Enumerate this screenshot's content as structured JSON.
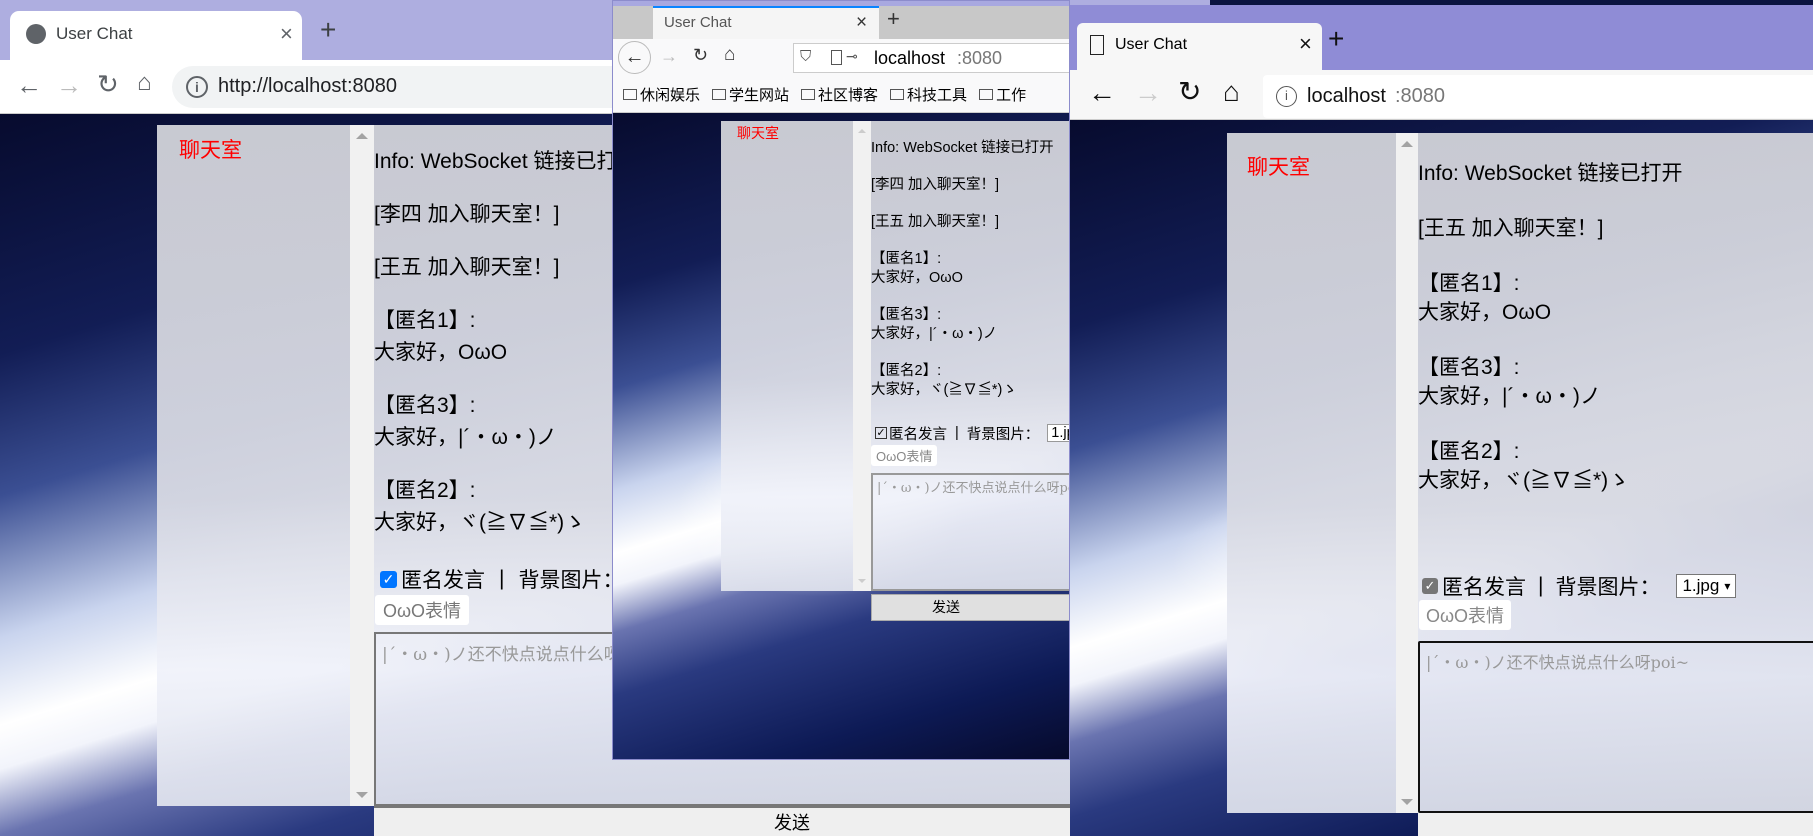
{
  "chat": {
    "room_title": "聊天室",
    "anonymous_label": "匿名发言",
    "separator": "|",
    "bg_label": "背景图片：",
    "bg_select_value": "1.jpg",
    "emoji_button": "OωO表情",
    "input_placeholder": "|´・ω・)ノ还不快点说点什么呀poi~",
    "send_label": "发送"
  },
  "windows": [
    {
      "browser": "Chrome",
      "tab_title": "User Chat",
      "url": "http://localhost:8080",
      "messages": [
        {
          "text": "Info: WebSocket 链接已打开"
        },
        {
          "text": "[李四 加入聊天室！]"
        },
        {
          "text": "[王五 加入聊天室！]"
        },
        {
          "sender": "【匿名1】:",
          "text": "大家好，OωO"
        },
        {
          "sender": "【匿名3】:",
          "text": "大家好，|´・ω・)ノ"
        },
        {
          "sender": "【匿名2】:",
          "text": "大家好，ヾ(≧∇≦*)ゝ"
        }
      ]
    },
    {
      "browser": "Firefox",
      "tab_title": "User Chat",
      "url_host": "localhost",
      "url_port": ":8080",
      "bookmarks": [
        "休闲娱乐",
        "学生网站",
        "社区博客",
        "科技工具",
        "工作"
      ],
      "messages": [
        {
          "text": "Info: WebSocket 链接已打开"
        },
        {
          "text": "[李四 加入聊天室！]"
        },
        {
          "text": "[王五 加入聊天室！]"
        },
        {
          "sender": "【匿名1】:",
          "text": "大家好，OωO"
        },
        {
          "sender": "【匿名3】:",
          "text": "大家好，|´・ω・)ノ"
        },
        {
          "sender": "【匿名2】:",
          "text": "大家好，ヾ(≧∇≦*)ゝ"
        }
      ]
    },
    {
      "browser": "Edge",
      "tab_title": "User Chat",
      "url_host": "localhost",
      "url_port": ":8080",
      "messages": [
        {
          "text": "Info: WebSocket 链接已打开"
        },
        {
          "text": "[王五 加入聊天室！]"
        },
        {
          "sender": "【匿名1】:",
          "text": "大家好，OωO"
        },
        {
          "sender": "【匿名3】:",
          "text": "大家好，|´・ω・)ノ"
        },
        {
          "sender": "【匿名2】:",
          "text": "大家好，ヾ(≧∇≦*)ゝ"
        }
      ]
    }
  ],
  "colors": {
    "title_red": "#ff0000",
    "chrome_frame": "#aeaee0",
    "edge_frame": "#8f8cd6",
    "firefox_accent": "#0a84ff"
  }
}
